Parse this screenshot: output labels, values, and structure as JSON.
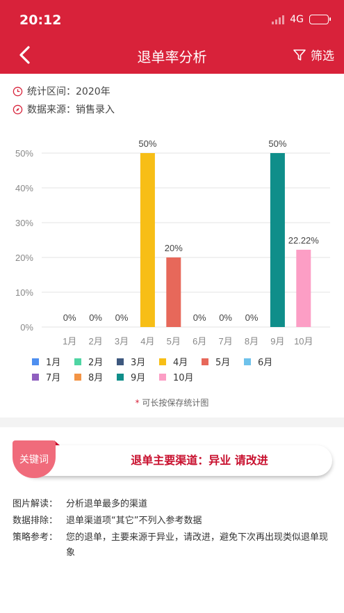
{
  "status_bar": {
    "time": "20:12",
    "network": "4G"
  },
  "nav": {
    "title": "退单率分析",
    "filter_label": "筛选"
  },
  "meta": {
    "period": "统计区间：2020年",
    "source": "数据来源：销售录入"
  },
  "chart_data": {
    "type": "bar",
    "categories": [
      "1月",
      "2月",
      "3月",
      "4月",
      "5月",
      "6月",
      "7月",
      "8月",
      "9月",
      "10月"
    ],
    "values": [
      0,
      0,
      0,
      50,
      20,
      0,
      0,
      0,
      50,
      22.22
    ],
    "value_labels": [
      "0%",
      "0%",
      "0%",
      "50%",
      "20%",
      "0%",
      "0%",
      "0%",
      "50%",
      "22.22%"
    ],
    "colors": [
      "#4e8ff0",
      "#4fd5a3",
      "#3e587e",
      "#f7be16",
      "#e7685a",
      "#6ec2eb",
      "#8f5fbf",
      "#f39445",
      "#0f8e8a",
      "#fc9ec5"
    ],
    "ylim": [
      0,
      50
    ],
    "yticks": [
      "0%",
      "10%",
      "20%",
      "30%",
      "40%",
      "50%"
    ],
    "grid": true,
    "legend_position": "bottom"
  },
  "hint": {
    "star": "*",
    "text": "可长按保存统计图"
  },
  "keyword": {
    "tag": "关键词",
    "text": "退单主要渠道：异业 请改进"
  },
  "notes": [
    {
      "key": "图片解读：",
      "value": "分析退单最多的渠道"
    },
    {
      "key": "数据排除：",
      "value": "退单渠道项“其它”不列入参考数据"
    },
    {
      "key": "策略参考：",
      "value": "您的退单，主要来源于异业，请改进，避免下次再出现类似退单现象"
    }
  ],
  "icons": {
    "back": "chevron-left-icon",
    "filter": "filter-icon",
    "period": "clock-icon",
    "source": "compass-icon"
  }
}
